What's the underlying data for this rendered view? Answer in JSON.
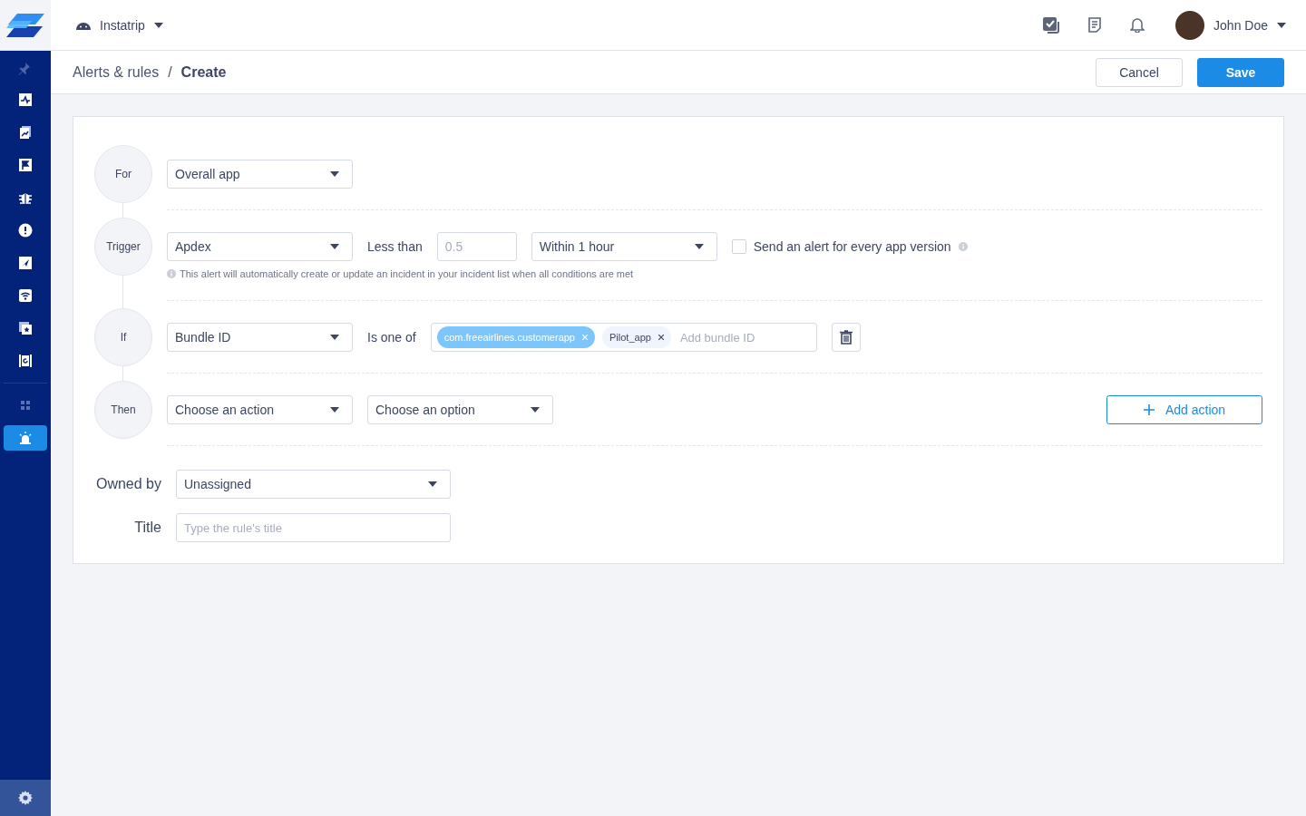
{
  "app_selector": {
    "name": "Instatrip"
  },
  "user": {
    "name": "John Doe"
  },
  "sidebar": {
    "items": [
      {
        "selected": false
      },
      {
        "selected": false
      },
      {
        "selected": false
      },
      {
        "selected": false
      },
      {
        "selected": false
      },
      {
        "selected": false
      },
      {
        "selected": false
      },
      {
        "selected": false
      },
      {
        "selected": false
      },
      {
        "selected": false
      },
      {
        "selected": false
      },
      {
        "selected": true
      }
    ]
  },
  "breadcrumb": {
    "separator": "/",
    "items": [
      {
        "label": "Alerts & rules",
        "current": false
      },
      {
        "label": "Create",
        "current": true
      }
    ]
  },
  "header_actions": {
    "cancel": "Cancel",
    "save": "Save"
  },
  "rules": [
    {
      "label": "For",
      "controls": [
        {
          "kind": "dropdown",
          "value": "Overall app"
        }
      ]
    },
    {
      "label": "Trigger",
      "controls": [
        {
          "kind": "dropdown",
          "value": "Apdex"
        },
        {
          "kind": "text",
          "text": "Less than"
        },
        {
          "kind": "input",
          "placeholder": "0.5"
        },
        {
          "kind": "dropdown",
          "value": "Within 1 hour"
        },
        {
          "kind": "checkbox",
          "label": "Send an alert for every app version",
          "checked": false
        }
      ],
      "note": "This alert will automatically create or update an incident in your incident list when all conditions are met"
    },
    {
      "label": "If",
      "controls": [
        {
          "kind": "dropdown",
          "value": "Bundle ID"
        },
        {
          "kind": "text",
          "text": "Is one of"
        },
        {
          "kind": "tags",
          "tags": [
            {
              "label": "com.freeairlines.customerapp",
              "selected": true
            },
            {
              "label": "Pilot_app",
              "selected": false
            }
          ],
          "placeholder": "Add bundle ID"
        },
        {
          "kind": "delete"
        }
      ]
    },
    {
      "label": "Then",
      "controls": [
        {
          "kind": "dropdown",
          "value": "Choose an action"
        },
        {
          "kind": "dropdown",
          "value": "Choose an option"
        }
      ],
      "action": "Add action"
    }
  ],
  "owner": {
    "label": "Owned by",
    "value": "Unassigned"
  },
  "title_field": {
    "label": "Title",
    "placeholder": "Type the rule's title"
  }
}
